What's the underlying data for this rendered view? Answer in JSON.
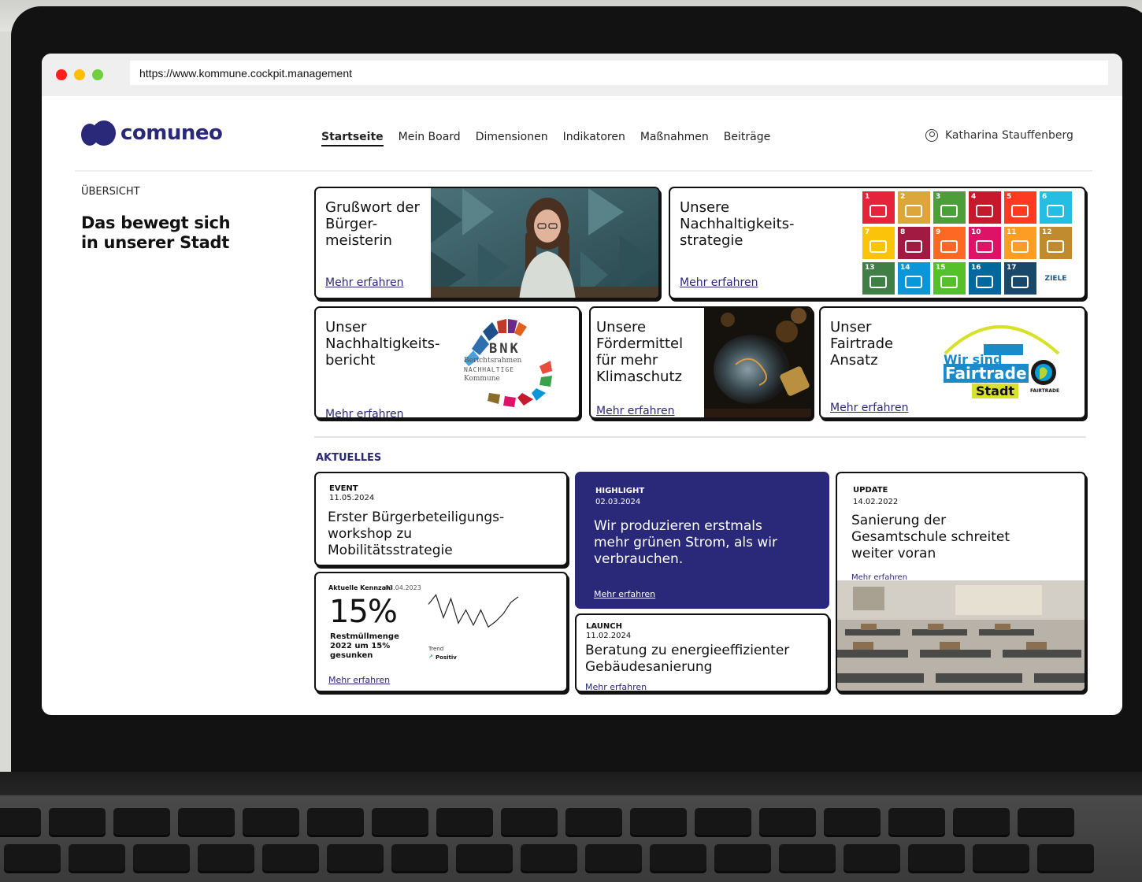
{
  "browser": {
    "url": "https://www.kommune.cockpit.management"
  },
  "brand": {
    "name": "comuneo",
    "color": "#2a2878"
  },
  "nav": {
    "items": [
      "Startseite",
      "Mein Board",
      "Dimensionen",
      "Indikatoren",
      "Maßnahmen",
      "Beiträge"
    ],
    "active": "Startseite"
  },
  "user": {
    "name": "Katharina Stauffenberg",
    "icon": "user-circle-icon"
  },
  "sidebar": {
    "overline": "ÜBERSICHT",
    "title": "Das bewegt sich in unserer Stadt"
  },
  "tiles": {
    "grusswort": {
      "title": "Grußwort der\nBürger-\nmeisterin",
      "link": "Mehr erfahren"
    },
    "strategie": {
      "title": "Unsere\nNachhaltigkeits-\nstrategie",
      "link": "Mehr erfahren"
    },
    "bericht": {
      "title": "Unser\nNachhaltigkeits-\nbericht",
      "link": "Mehr erfahren"
    },
    "foerdermittel": {
      "title": "Unsere\nFördermittel\nfür mehr\nKlimaschutz",
      "link": "Mehr erfahren"
    },
    "fairtrade": {
      "title": "Unser\nFairtrade\nAnsatz",
      "link": "Mehr erfahren"
    }
  },
  "bnk": {
    "title": "BNK",
    "line1": "Berichtsrahmen",
    "line2": "NACHHALTIGE",
    "line3": "Kommune"
  },
  "fairtrade_logo": {
    "line1": "Wir sind",
    "line2": "Fairtrade",
    "line3": "Stadt",
    "mark": "FAIRTRADE"
  },
  "sdg": {
    "goals": [
      {
        "n": "1",
        "color": "#e5243b"
      },
      {
        "n": "2",
        "color": "#dda63a"
      },
      {
        "n": "3",
        "color": "#4c9f38"
      },
      {
        "n": "4",
        "color": "#c5192d"
      },
      {
        "n": "5",
        "color": "#ff3a21"
      },
      {
        "n": "6",
        "color": "#26bde2"
      },
      {
        "n": "7",
        "color": "#fcc30b"
      },
      {
        "n": "8",
        "color": "#a21942"
      },
      {
        "n": "9",
        "color": "#fd6925"
      },
      {
        "n": "10",
        "color": "#dd1367"
      },
      {
        "n": "11",
        "color": "#fd9d24"
      },
      {
        "n": "12",
        "color": "#bf8b2e"
      },
      {
        "n": "13",
        "color": "#3f7e44"
      },
      {
        "n": "14",
        "color": "#0a97d9"
      },
      {
        "n": "15",
        "color": "#56c02b"
      },
      {
        "n": "16",
        "color": "#00689d"
      },
      {
        "n": "17",
        "color": "#19486a"
      }
    ],
    "ziele_label": "ZIELE"
  },
  "news": {
    "section_label": "AKTUELLES",
    "event": {
      "tag": "EVENT",
      "date": "11.05.2024",
      "title": "Erster Bürgerbeteiligungs-\nworkshop zu\nMobilitätsstrategie"
    },
    "highlight": {
      "tag": "HIGHLIGHT",
      "date": "02.03.2024",
      "title": "Wir produzieren erstmals\nmehr grünen Strom, als wir\nverbrauchen.",
      "link": "Mehr erfahren"
    },
    "update": {
      "tag": "UPDATE",
      "date": "14.02.2022",
      "title": "Sanierung der\nGesamtschule schreitet\nweiter voran",
      "link": "Mehr erfahren"
    },
    "launch": {
      "tag": "LAUNCH",
      "date": "11.02.2024",
      "title": "Beratung zu energieeffizienter\nGebäudesanierung",
      "link": "Mehr erfahren"
    }
  },
  "kpi": {
    "label": "Aktuelle Kennzahl",
    "date": "03.04.2023",
    "value": "15%",
    "description": "Restmüllmenge\n2022 um 15%\ngesunken",
    "trend_label": "Trend",
    "trend_value": "Positiv",
    "link": "Mehr erfahren",
    "sparkline": [
      0.7,
      0.95,
      0.35,
      0.85,
      0.2,
      0.55,
      0.15,
      0.55,
      0.1,
      0.25,
      0.45,
      0.75,
      0.9
    ]
  }
}
